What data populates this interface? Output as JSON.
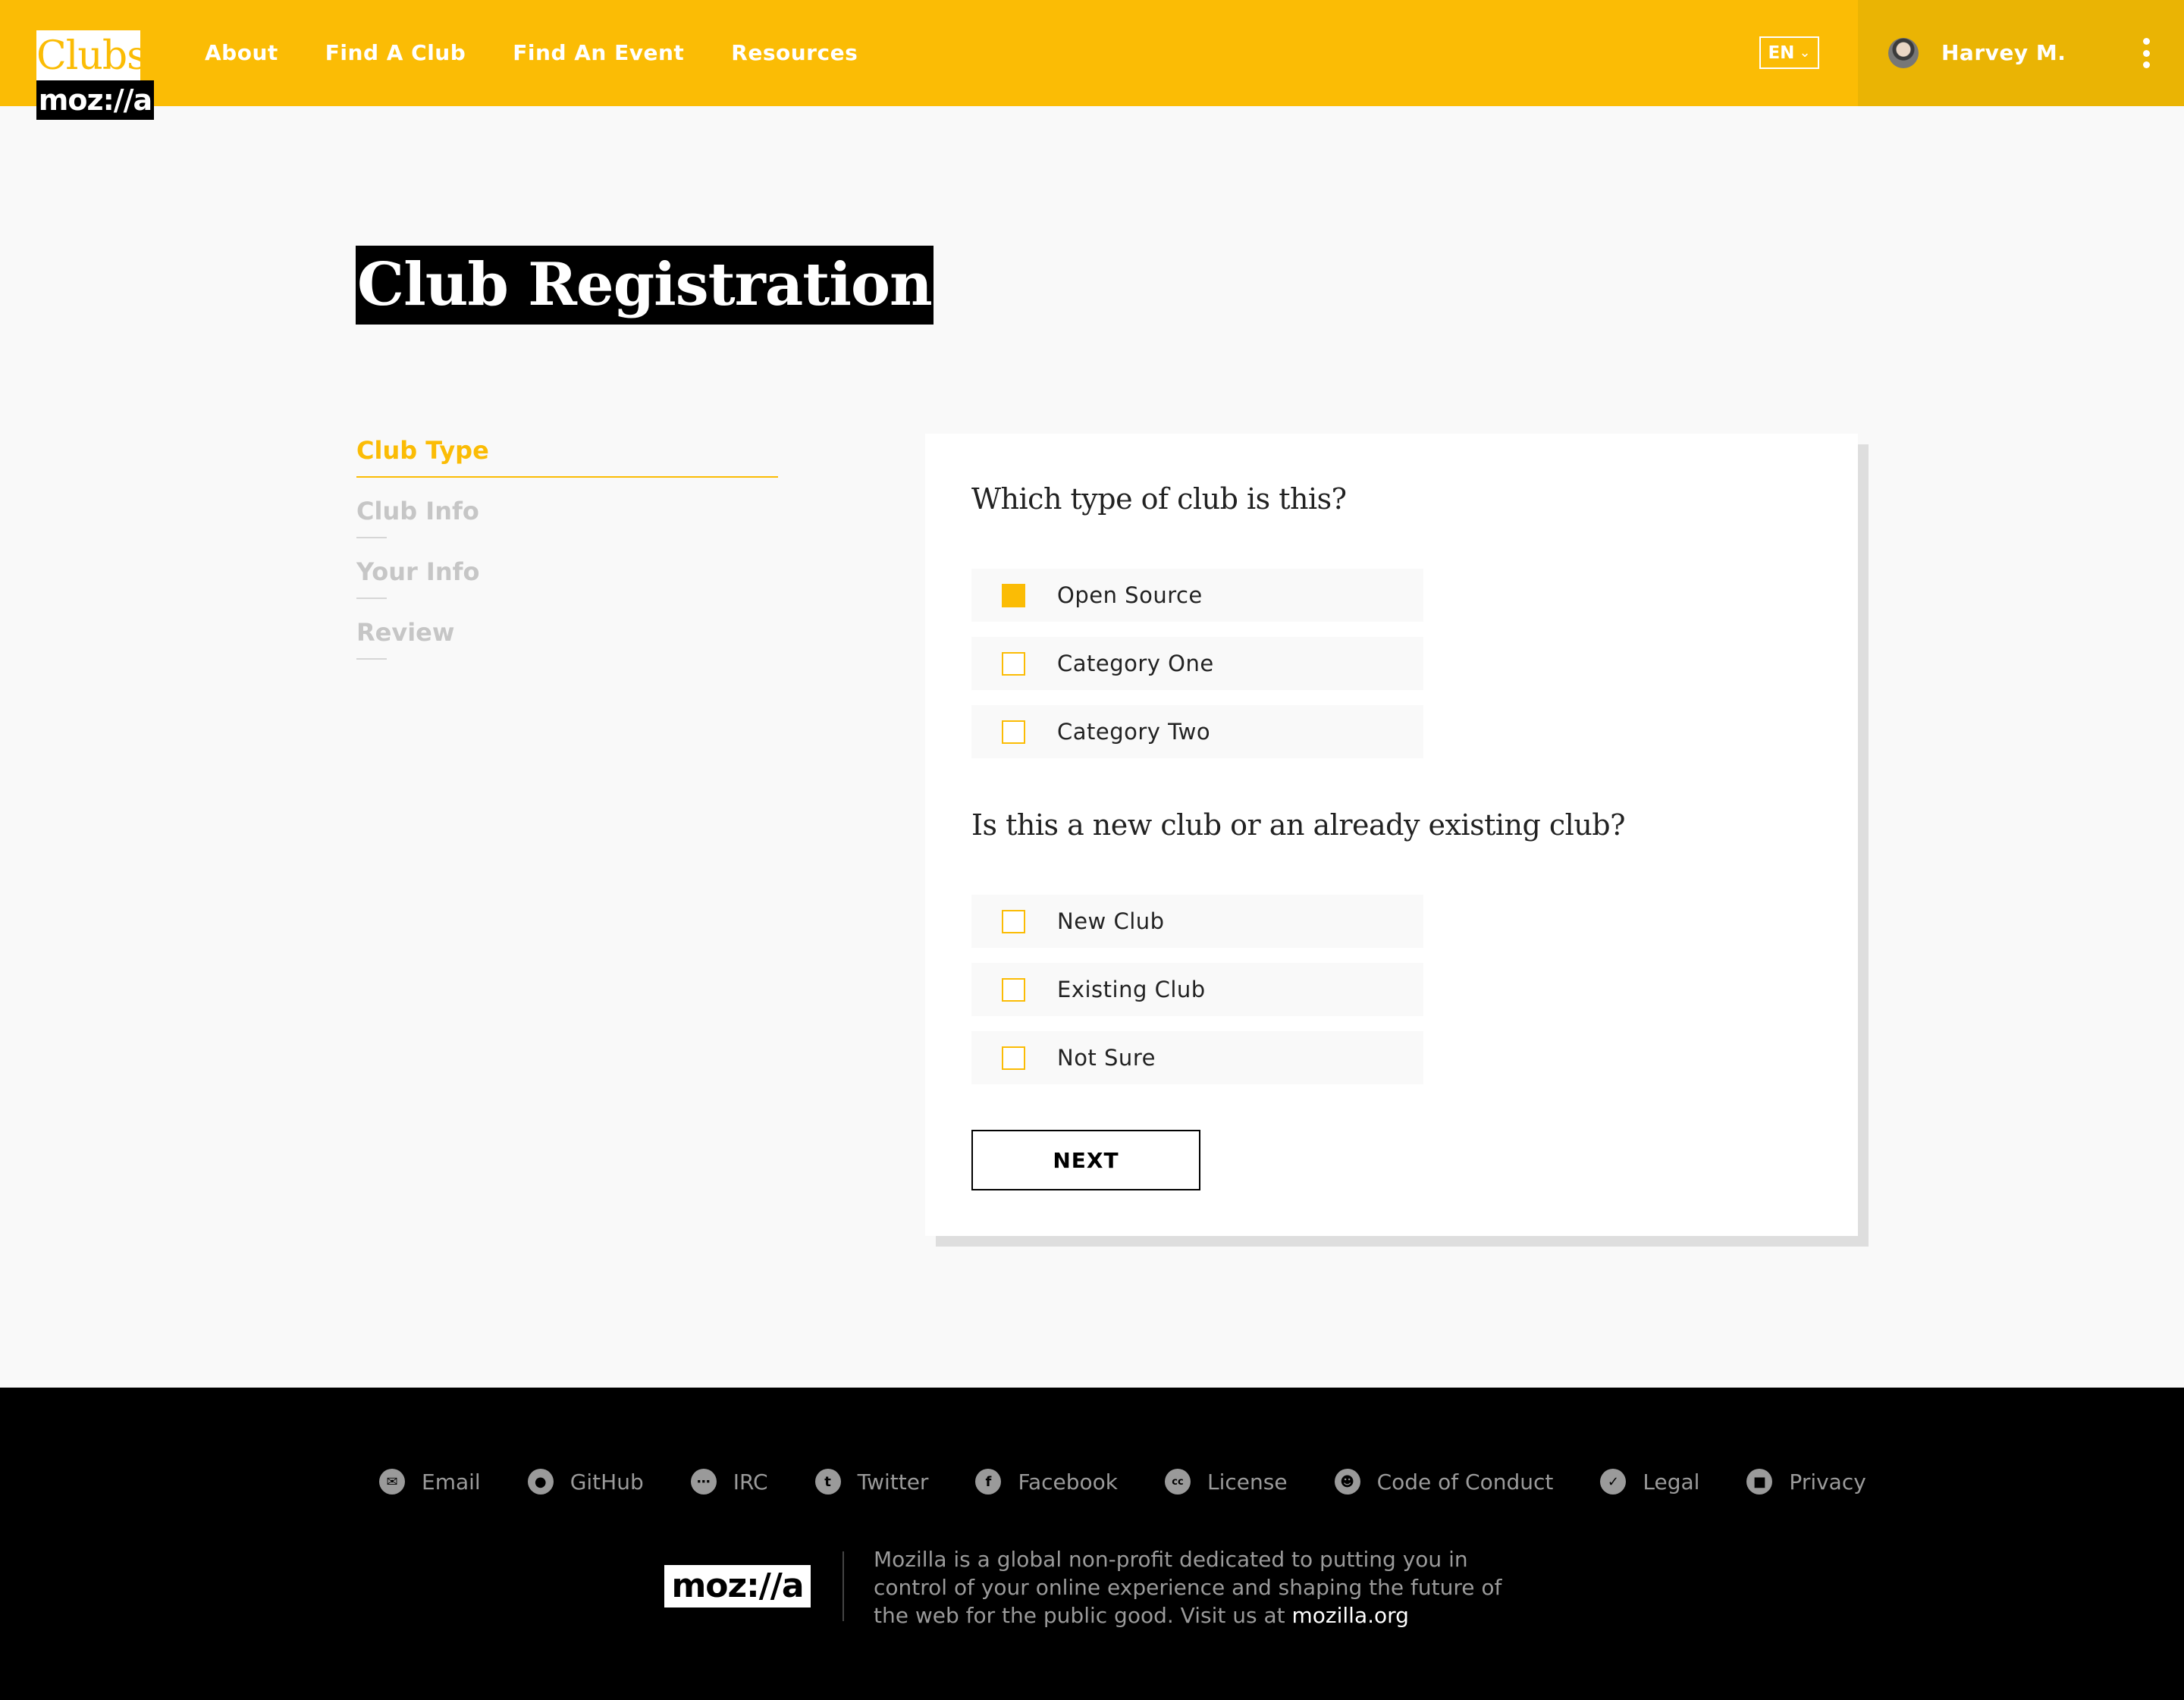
{
  "header": {
    "logo_top": "Clubs",
    "logo_bottom": "moz://a",
    "nav": [
      "About",
      "Find A Club",
      "Find An Event",
      "Resources"
    ],
    "language": "EN",
    "user_name": "Harvey M."
  },
  "page_title": "Club Registration",
  "steps": [
    {
      "label": "Club Type",
      "active": true
    },
    {
      "label": "Club Info",
      "active": false
    },
    {
      "label": "Your Info",
      "active": false
    },
    {
      "label": "Review",
      "active": false
    }
  ],
  "form": {
    "question1": "Which type of club is this?",
    "options1": [
      {
        "label": "Open Source",
        "checked": true
      },
      {
        "label": "Category One",
        "checked": false
      },
      {
        "label": "Category Two",
        "checked": false
      }
    ],
    "question2": "Is this a new club or an already existing club?",
    "options2": [
      {
        "label": "New Club",
        "checked": false
      },
      {
        "label": "Existing Club",
        "checked": false
      },
      {
        "label": "Not Sure",
        "checked": false
      }
    ],
    "next_label": "NEXT"
  },
  "footer": {
    "links": [
      {
        "label": "Email",
        "icon": "email-icon"
      },
      {
        "label": "GitHub",
        "icon": "github-icon"
      },
      {
        "label": "IRC",
        "icon": "chat-bubble-icon"
      },
      {
        "label": "Twitter",
        "icon": "twitter-icon"
      },
      {
        "label": "Facebook",
        "icon": "facebook-icon"
      },
      {
        "label": "License",
        "icon": "creative-commons-icon"
      },
      {
        "label": "Code of Conduct",
        "icon": "smiley-icon"
      },
      {
        "label": "Legal",
        "icon": "checkmark-icon"
      },
      {
        "label": "Privacy",
        "icon": "lock-icon"
      }
    ],
    "logo": "moz://a",
    "description": "Mozilla is a global non-profit dedicated to putting you in control of your online experience and shaping the future of the web for the public good. Visit us at ",
    "site_link": "mozilla.org"
  },
  "colors": {
    "accent": "#fbbc05",
    "accent_dark": "#eab404",
    "footer_bg": "#000000"
  }
}
